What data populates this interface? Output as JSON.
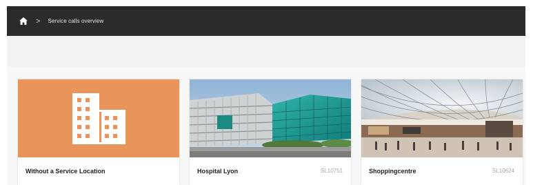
{
  "header": {
    "home_icon": "home-icon",
    "separator_icon": "chevron-right-icon",
    "breadcrumb_title": "Service calls overview"
  },
  "cards": [
    {
      "title": "Without a Service Location",
      "code": "",
      "media": "building-icon",
      "accent": "#E8945B"
    },
    {
      "title": "Hospital Lyon",
      "code": "SL10751",
      "media": "photo-hospital-building"
    },
    {
      "title": "Shoppingcentre",
      "code": "SL10624",
      "media": "photo-shopping-mall-interior"
    }
  ]
}
